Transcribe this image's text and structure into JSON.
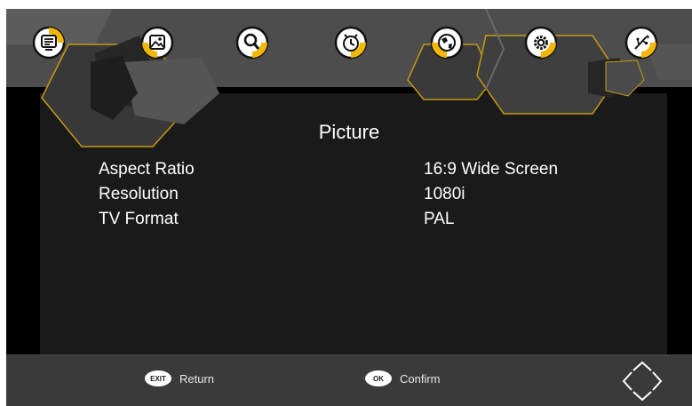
{
  "menu": {
    "icons": [
      "tv-channel-icon",
      "picture-icon",
      "search-icon",
      "clock-icon",
      "globe-icon",
      "gear-icon",
      "usb-icon"
    ],
    "accent_color": "#f2b705",
    "active_icon": "gear-icon"
  },
  "page": {
    "title": "Picture"
  },
  "settings": [
    {
      "label": "Aspect Ratio",
      "value": "16:9 Wide Screen"
    },
    {
      "label": "Resolution",
      "value": "1080i"
    },
    {
      "label": "TV Format",
      "value": "PAL"
    }
  ],
  "footer": {
    "exit_key": "EXIT",
    "exit_label": "Return",
    "ok_key": "OK",
    "ok_label": "Confirm",
    "nav_icon": "dpad-arrows-icon"
  }
}
